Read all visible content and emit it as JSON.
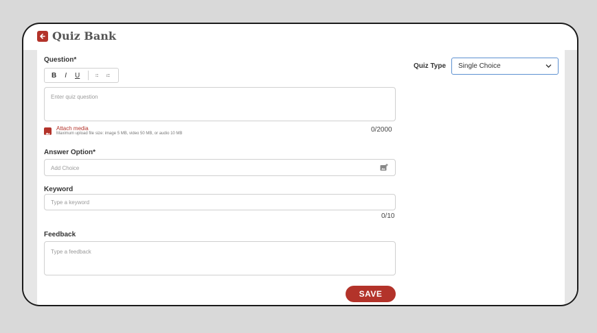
{
  "header": {
    "title": "Quiz Bank"
  },
  "question": {
    "label": "Question*",
    "toolbar": {
      "bold": "B",
      "italic": "I",
      "underline": "U"
    },
    "placeholder": "Enter quiz question",
    "counter": "0/2000"
  },
  "media": {
    "label": "Attach media",
    "note": "Maximum upload file size: image 5 MB, video 50 MB, or audio 10 MB"
  },
  "answer": {
    "label": "Answer Option*",
    "placeholder": "Add Choice"
  },
  "keyword": {
    "label": "Keyword",
    "placeholder": "Type a keyword",
    "counter": "0/10"
  },
  "feedback": {
    "label": "Feedback",
    "placeholder": "Type a feedback"
  },
  "quiz_type": {
    "label": "Quiz Type",
    "value": "Single Choice"
  },
  "save_label": "SAVE",
  "colors": {
    "accent": "#b3332a",
    "select_border": "#5b8fd0"
  },
  "icons": [
    "back-arrow-icon",
    "bullet-list-icon",
    "numbered-list-icon",
    "image-icon",
    "add-image-icon",
    "chevron-down-icon"
  ]
}
